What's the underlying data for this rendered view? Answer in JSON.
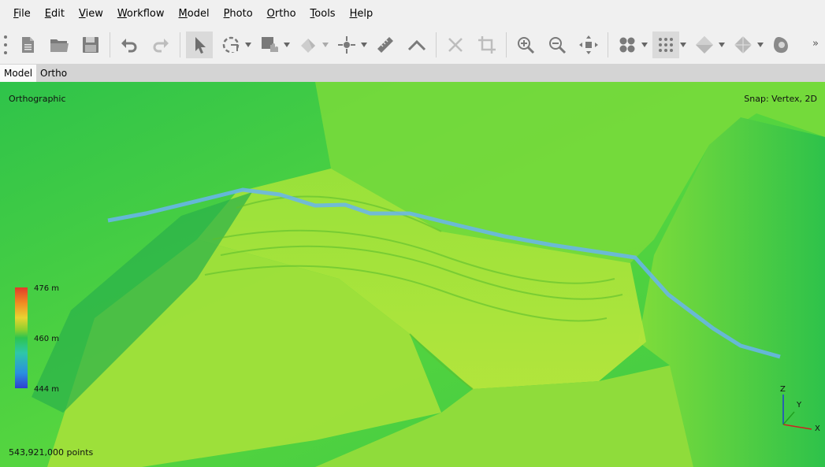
{
  "menu": [
    {
      "mnemonic": "F",
      "rest": "ile"
    },
    {
      "mnemonic": "E",
      "rest": "dit"
    },
    {
      "mnemonic": "V",
      "rest": "iew"
    },
    {
      "mnemonic": "W",
      "rest": "orkflow"
    },
    {
      "mnemonic": "M",
      "rest": "odel"
    },
    {
      "mnemonic": "P",
      "rest": "hoto"
    },
    {
      "mnemonic": "O",
      "rest": "rtho"
    },
    {
      "mnemonic": "T",
      "rest": "ools"
    },
    {
      "mnemonic": "H",
      "rest": "elp"
    }
  ],
  "toolbar_icons": [
    "new-document-icon",
    "open-folder-icon",
    "save-icon",
    "undo-icon",
    "redo-icon",
    "select-pointer-icon",
    "rotate-selection-icon",
    "shape-selection-icon",
    "paint-selection-icon",
    "marker-icon",
    "ruler-icon",
    "polyline-icon",
    "delete-icon",
    "crop-icon",
    "zoom-in-icon",
    "zoom-out-icon",
    "reset-view-icon",
    "point-cloud-icon",
    "dense-cloud-icon",
    "model-shaded-icon",
    "model-wireframe-icon",
    "tiled-model-icon"
  ],
  "tabs": [
    "Model",
    "Ortho"
  ],
  "viewport": {
    "projection": "Orthographic",
    "snap": "Snap: Vertex, 2D",
    "points": "543,921,000 points"
  },
  "legend": {
    "max": "476 m",
    "mid": "460 m",
    "min": "444 m"
  },
  "axes": {
    "z": "Z",
    "y": "Y",
    "x": "X"
  },
  "colors": {
    "profile_line": "#6ab4f0",
    "terrain_base": "#2fc34a",
    "terrain_high": "#a8e63a"
  }
}
